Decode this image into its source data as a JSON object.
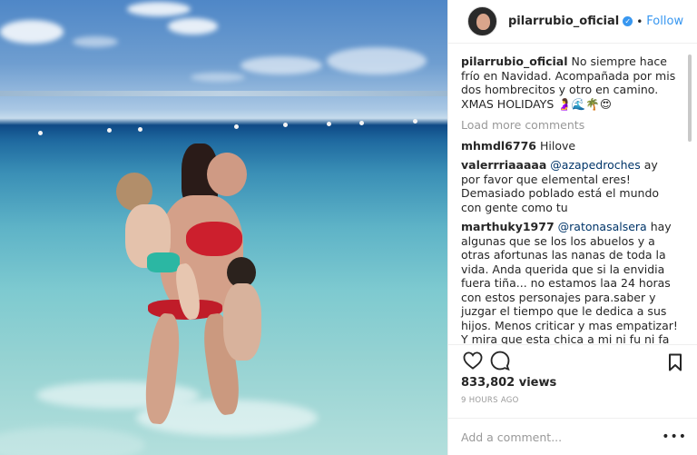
{
  "post": {
    "username": "pilarrubio_oficial",
    "verified_icon": "verified-badge-icon",
    "follow_label": "Follow",
    "separator": "•"
  },
  "caption": {
    "username": "pilarrubio_oficial",
    "text": "No siempre hace frío en Navidad. Acompañada por mis dos hombrecitos y otro en camino. XMAS HOLIDAYS 🤰🌊🌴😍"
  },
  "load_more_label": "Load more comments",
  "comments": [
    {
      "username": "mhmdl6776",
      "mention": "",
      "text": "Hilove"
    },
    {
      "username": "valerrriaaaaa",
      "mention": "@azapedroches",
      "text": "ay por favor que elemental eres! Demasiado poblado está el mundo con gente como tu"
    },
    {
      "username": "marthuky1977",
      "mention": "@ratonasalsera",
      "text": "hay algunas que se los los abuelos y a otras afortunas las nanas de toda la vida. Anda querida que si la envidia fuera tiña... no estamos laa 24 horas con estos personajes para.saber y juzgar el tiempo que le dedica a sus hijos. Menos criticar y mas empatizar! Y mira que esta chica a mi ni fu ni fa"
    }
  ],
  "actions": {
    "like_icon": "heart-icon",
    "comment_icon": "comment-bubble-icon",
    "save_icon": "bookmark-icon"
  },
  "likes_text": "833,802 views",
  "timestamp": "9 HOURS AGO",
  "add_comment": {
    "placeholder": "Add a comment...",
    "more_label": "•••"
  },
  "colors": {
    "link_blue": "#3897f0",
    "mention_blue": "#003569",
    "muted": "#999999",
    "text": "#262626"
  }
}
